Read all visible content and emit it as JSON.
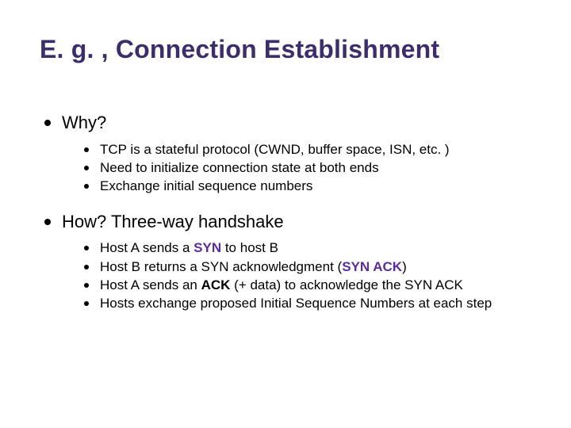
{
  "title": "E. g. , Connection Establishment",
  "sections": [
    {
      "heading": "Why?",
      "items": [
        {
          "segments": [
            {
              "t": "TCP is a stateful protocol (CWND, buffer space, ISN, etc. )"
            }
          ]
        },
        {
          "segments": [
            {
              "t": "Need to initialize connection state at both ends"
            }
          ]
        },
        {
          "segments": [
            {
              "t": "Exchange initial sequence numbers"
            }
          ]
        }
      ]
    },
    {
      "heading": "How? Three-way handshake",
      "items": [
        {
          "segments": [
            {
              "t": "Host A sends a "
            },
            {
              "t": "SYN",
              "bold": true,
              "purple": true
            },
            {
              "t": " to host B"
            }
          ]
        },
        {
          "segments": [
            {
              "t": "Host B returns a SYN acknowledgment ("
            },
            {
              "t": "SYN ACK",
              "bold": true,
              "purple": true
            },
            {
              "t": ")"
            }
          ]
        },
        {
          "segments": [
            {
              "t": "Host A sends an "
            },
            {
              "t": "ACK",
              "bold": true
            },
            {
              "t": " (+ data) to acknowledge the SYN ACK"
            }
          ]
        },
        {
          "segments": [
            {
              "t": "Hosts exchange proposed Initial Sequence Numbers at each step"
            }
          ]
        }
      ]
    }
  ]
}
